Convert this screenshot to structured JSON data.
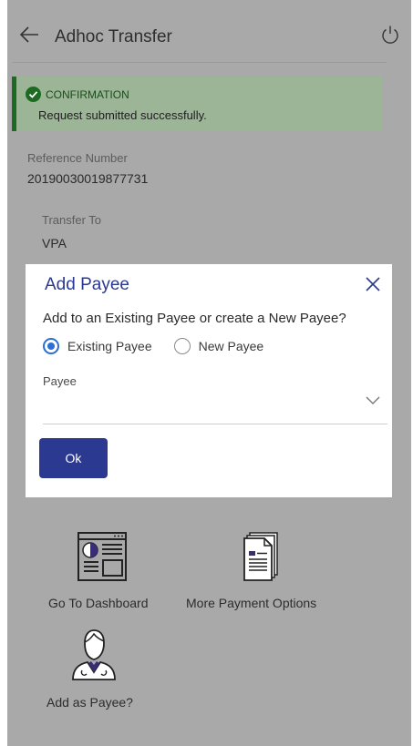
{
  "header": {
    "title": "Adhoc Transfer",
    "back_icon": "arrow-left-icon",
    "power_icon": "power-icon"
  },
  "banner": {
    "title": "CONFIRMATION",
    "message": "Request submitted successfully.",
    "icon": "check-circle-icon",
    "color": "#1d6a22"
  },
  "details": {
    "reference_label": "Reference Number",
    "reference_value": "20190030019877731",
    "transfer_to_label": "Transfer To",
    "transfer_to_value": "VPA"
  },
  "modal": {
    "title": "Add Payee",
    "question": "Add to an Existing Payee or create a New Payee?",
    "options": [
      "Existing Payee",
      "New Payee"
    ],
    "selected_option": "Existing Payee",
    "payee_label": "Payee",
    "payee_value": "",
    "ok_label": "Ok",
    "accent_color": "#2b3990"
  },
  "options": {
    "dashboard_label": "Go To Dashboard",
    "more_payments_label": "More Payment Options",
    "add_payee_label": "Add as Payee?"
  }
}
